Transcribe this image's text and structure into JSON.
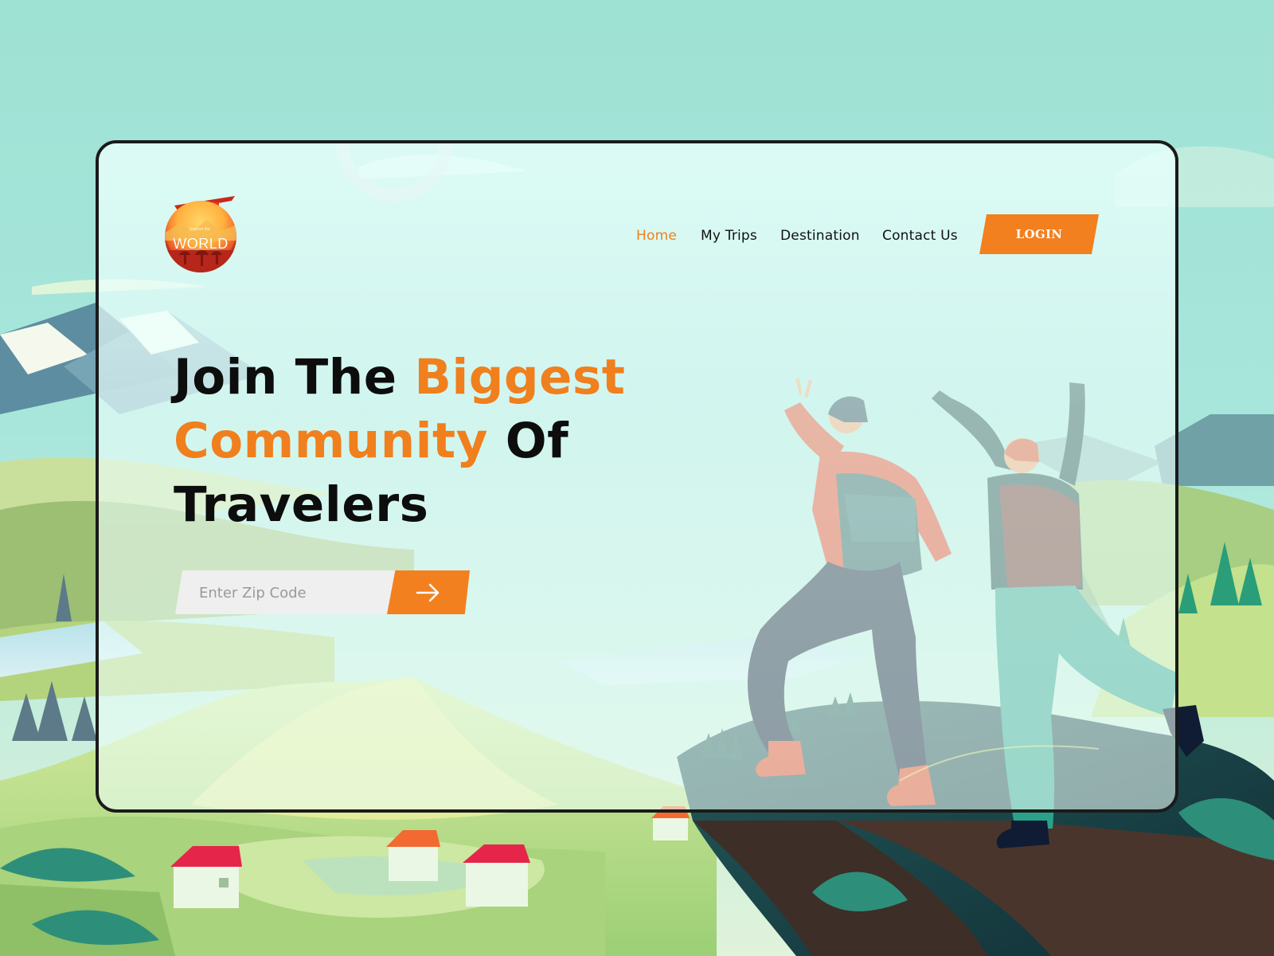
{
  "brand": {
    "logo_text": "WORLD",
    "logo_subtext": "Explore the"
  },
  "nav": {
    "items": [
      {
        "label": "Home",
        "active": true
      },
      {
        "label": "My Trips",
        "active": false
      },
      {
        "label": "Destination",
        "active": false
      },
      {
        "label": "Contact Us",
        "active": false
      }
    ],
    "login_label": "LOGIN"
  },
  "hero": {
    "line1_part1": "Join The ",
    "line1_part2": "Biggest",
    "line2_part1": "Community",
    "line2_part2": " Of",
    "line3": "Travelers"
  },
  "search": {
    "placeholder": "Enter Zip Code",
    "value": "",
    "submit_icon": "arrow-right-icon"
  },
  "colors": {
    "accent": "#f07f1d",
    "text": "#111111",
    "background": "#9ee2d3"
  }
}
